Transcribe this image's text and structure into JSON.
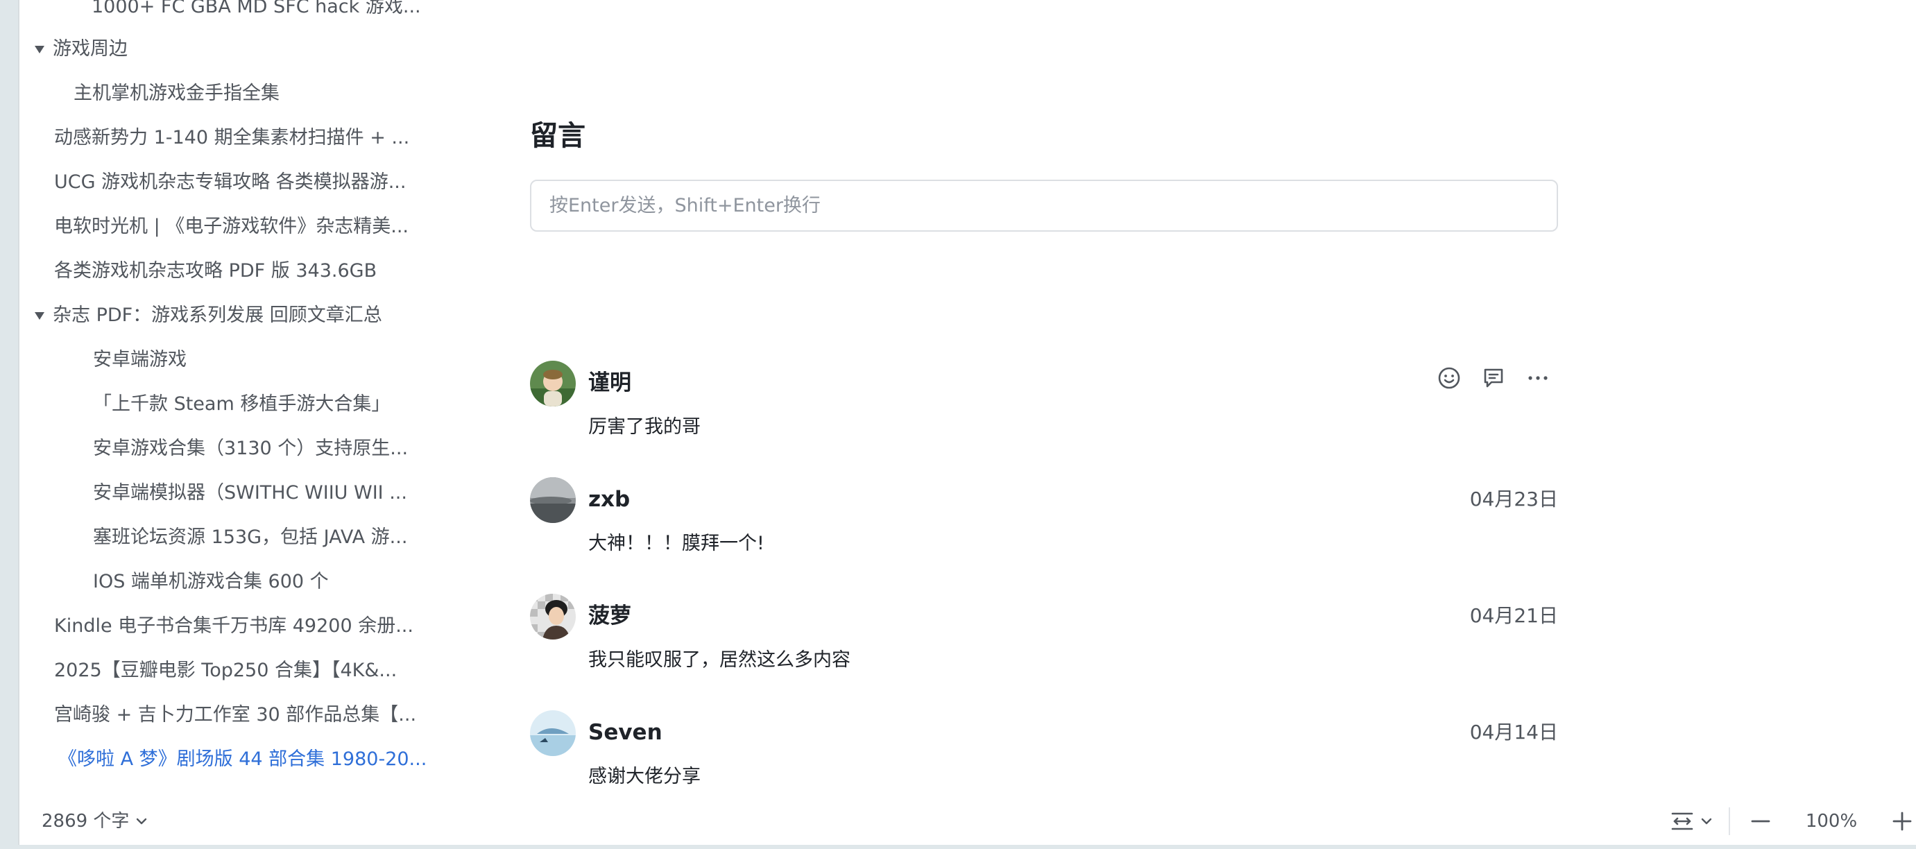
{
  "sidebar": {
    "items": [
      {
        "label": "1000+ FC GBA MD SFC hack 游戏..."
      },
      {
        "label": "游戏周边"
      },
      {
        "label": "主机掌机游戏金手指全集"
      },
      {
        "label": "动感新势力 1-140 期全集素材扫描件 + ..."
      },
      {
        "label": "UCG 游戏机杂志专辑攻略 各类模拟器游..."
      },
      {
        "label": "电软时光机 | 《电子游戏软件》杂志精美..."
      },
      {
        "label": "各类游戏机杂志攻略 PDF 版 343.6GB"
      },
      {
        "label": "杂志 PDF：游戏系列发展 回顾文章汇总"
      },
      {
        "label": "安卓端游戏"
      },
      {
        "label": "「上千款 Steam 移植手游大合集」"
      },
      {
        "label": "安卓游戏合集（3130 个）支持原生..."
      },
      {
        "label": "安卓端模拟器（SWITHC WIIU WII ..."
      },
      {
        "label": "塞班论坛资源 153G，包括 JAVA 游..."
      },
      {
        "label": "IOS 端单机游戏合集 600 个"
      },
      {
        "label": "Kindle 电子书合集千万书库 49200 余册..."
      },
      {
        "label": "2025【豆瓣电影 Top250 合集】【4K&..."
      },
      {
        "label": "宫崎骏 + 吉卜力工作室 30 部作品总集【..."
      },
      {
        "label": "《哆啦 A 梦》剧场版 44 部合集 1980-20..."
      }
    ]
  },
  "comments_section": {
    "title": "留言",
    "input_placeholder": "按Enter发送，Shift+Enter换行"
  },
  "comments": [
    {
      "author": "谨明",
      "date": "",
      "text": "厉害了我的哥",
      "avatar": "photo-avatar-child"
    },
    {
      "author": "zxb",
      "date": "04月23日",
      "text": "大神！！！膜拜一个!",
      "avatar": "photo-avatar-landscape"
    },
    {
      "author": "菠萝",
      "date": "04月21日",
      "text": "我只能叹服了，居然这么多内容",
      "avatar": "photo-avatar-portrait"
    },
    {
      "author": "Seven",
      "date": "04月14日",
      "text": "感谢大佬分享",
      "avatar": "photo-avatar-sea"
    }
  ],
  "statusbar": {
    "word_count": "2869 个字",
    "zoom": "100%"
  },
  "colors": {
    "link_active": "#2f6fd8",
    "text_secondary": "#51565d",
    "border": "#dcdfe3"
  }
}
